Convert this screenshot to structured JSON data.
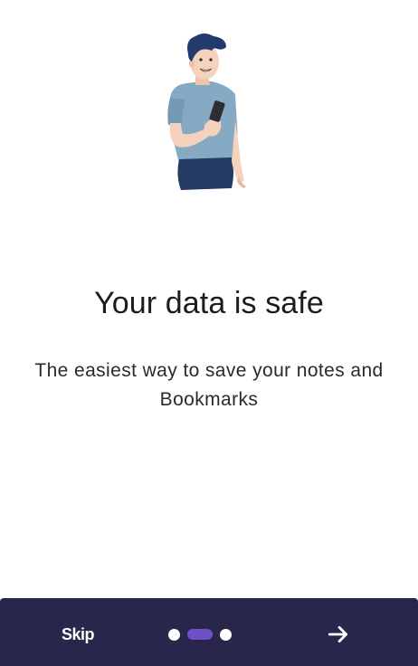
{
  "onboarding": {
    "title": "Your data is safe",
    "subtitle": "The easiest way to save your notes and Bookmarks",
    "illustration_icon": "person-with-phone-illustration"
  },
  "bottom_bar": {
    "skip_label": "Skip",
    "next_icon": "arrow-right-icon",
    "page_count": 3,
    "current_page": 2,
    "colors": {
      "bar_background": "#28264a",
      "active_indicator": "#6f4fc4",
      "inactive_indicator": "#ffffff",
      "text": "#ffffff"
    }
  }
}
